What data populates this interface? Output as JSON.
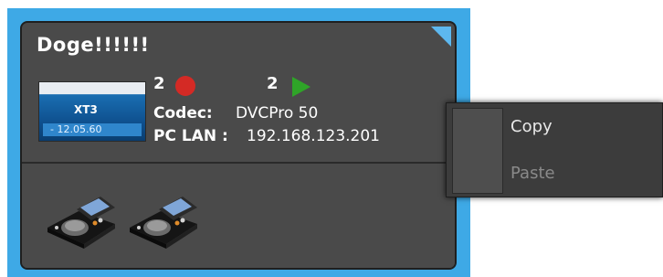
{
  "card": {
    "title": "Doge!!!!!!",
    "thumbnail": {
      "logo_text": "XT3",
      "version": "- 12.05.60"
    },
    "record_count": "2",
    "play_count": "2",
    "codec_label": "Codec:",
    "codec_value": "DVCPro 50",
    "lan_label": "PC LAN :",
    "lan_value": "192.168.123.201",
    "controllers": [
      "controller-icon",
      "controller-icon"
    ]
  },
  "context_menu": {
    "items": [
      {
        "label": "Copy",
        "enabled": true
      },
      {
        "label": "Paste",
        "enabled": false
      }
    ]
  },
  "colors": {
    "selection": "#3ea9e6",
    "card_bg": "#4a4a4a",
    "record": "#d42a25",
    "play": "#2fa428",
    "menu_bg": "#3c3c3c"
  }
}
